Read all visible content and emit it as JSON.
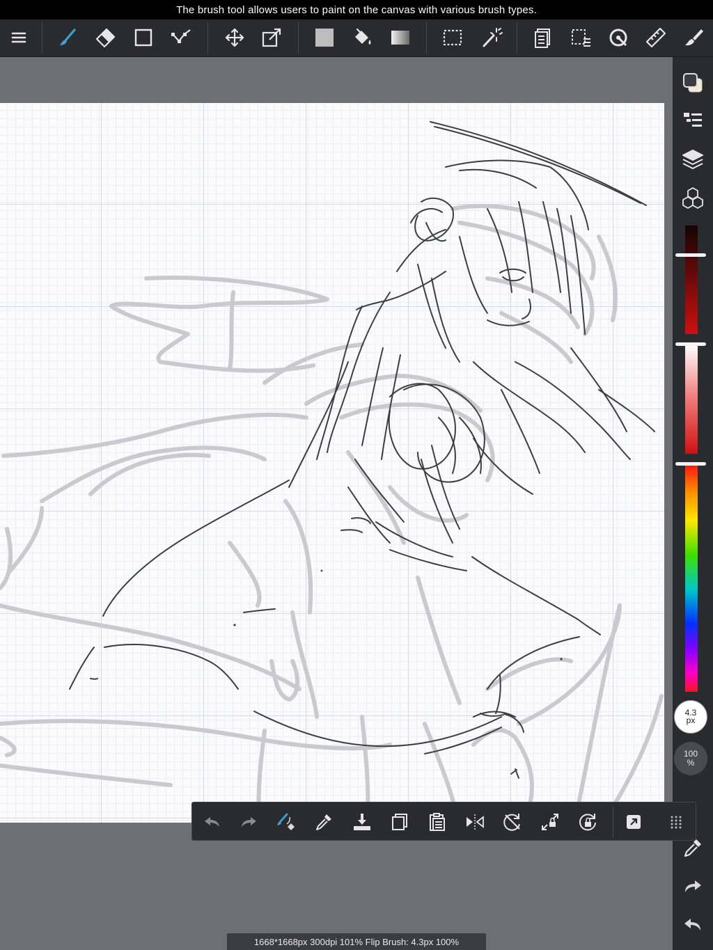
{
  "tooltip": {
    "text": "The brush tool allows users to paint on the canvas with various brush types."
  },
  "toolbar": {
    "items": [
      {
        "name": "menu",
        "icon": "menu-icon"
      },
      {
        "name": "brush",
        "icon": "brush-icon",
        "active": true
      },
      {
        "name": "eraser",
        "icon": "eraser-icon"
      },
      {
        "name": "shape",
        "icon": "rectangle-icon"
      },
      {
        "name": "stroke-edit",
        "icon": "stroke-edit-icon"
      },
      {
        "name": "move",
        "icon": "move-icon"
      },
      {
        "name": "transform",
        "icon": "transform-icon"
      },
      {
        "name": "fill-color",
        "icon": "fill-swatch-icon"
      },
      {
        "name": "bucket",
        "icon": "bucket-icon"
      },
      {
        "name": "gradient",
        "icon": "gradient-icon"
      },
      {
        "name": "select",
        "icon": "selection-icon"
      },
      {
        "name": "magic-wand",
        "icon": "magic-wand-icon"
      },
      {
        "name": "layer-list",
        "icon": "pages-icon"
      },
      {
        "name": "selection-list",
        "icon": "selection-list-icon"
      },
      {
        "name": "snap",
        "icon": "snap-icon"
      },
      {
        "name": "ruler",
        "icon": "ruler-icon"
      },
      {
        "name": "brush-settings",
        "icon": "brush-settings-icon"
      }
    ]
  },
  "sidebar": {
    "items": [
      {
        "name": "color-swap",
        "icon": "color-swatch-icon"
      },
      {
        "name": "properties",
        "icon": "list-icon"
      },
      {
        "name": "layers",
        "icon": "layers-icon"
      },
      {
        "name": "materials",
        "icon": "cubes-icon"
      }
    ],
    "brush_size": {
      "value": "4.3",
      "unit": "px"
    },
    "opacity": {
      "value": "100",
      "unit": "%"
    },
    "bottom_items": [
      {
        "name": "eyedropper",
        "icon": "eyedropper-icon"
      },
      {
        "name": "redo",
        "icon": "redo-icon"
      },
      {
        "name": "undo",
        "icon": "undo-icon"
      }
    ],
    "slider_levels": {
      "dark_red": 0.12,
      "light_red": 0.0,
      "hue": 0.0
    }
  },
  "quickbar": {
    "items": [
      {
        "name": "undo",
        "icon": "undo-icon"
      },
      {
        "name": "redo",
        "icon": "redo-icon"
      },
      {
        "name": "brush-eraser-toggle",
        "icon": "brush-eraser-icon"
      },
      {
        "name": "eyedropper",
        "icon": "eyedropper-icon"
      },
      {
        "name": "save",
        "icon": "download-icon"
      },
      {
        "name": "copy",
        "icon": "copy-icon"
      },
      {
        "name": "paste",
        "icon": "paste-icon"
      },
      {
        "name": "flip",
        "icon": "flip-icon"
      },
      {
        "name": "rotate-reset",
        "icon": "rotate-reset-icon"
      },
      {
        "name": "fit",
        "icon": "fit-lock-icon"
      },
      {
        "name": "rotate-lock",
        "icon": "rotate-lock-icon"
      },
      {
        "name": "expand",
        "icon": "expand-icon"
      },
      {
        "name": "more",
        "icon": "grid-dots-icon"
      }
    ]
  },
  "canvas": {
    "background": "#fbfbfd",
    "grid_color": "#d7d8e6"
  },
  "colors": {
    "accent": "#3aa3d6",
    "toolbar": "#2a2b2f",
    "workspace": "#6d6f75"
  },
  "statusbar": {
    "text": "1668*1668px 300dpi 101% Flip Brush: 4.3px 100%"
  }
}
